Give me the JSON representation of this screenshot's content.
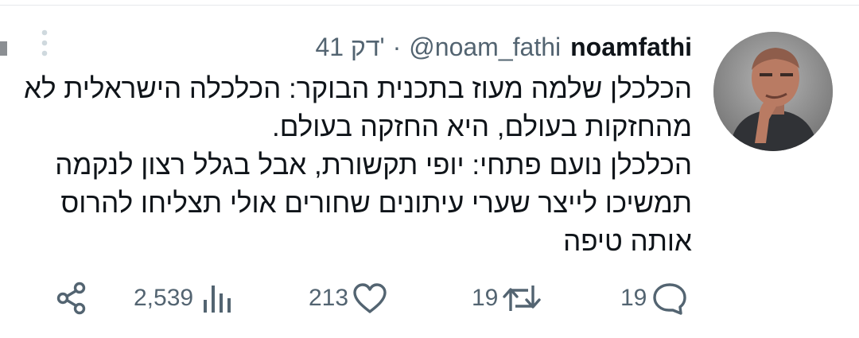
{
  "tweet": {
    "display_name": "noamfathi",
    "handle": "@noam_fathi",
    "separator": "·",
    "time": "41 דק'",
    "paragraphs": [
      "הכלכלן שלמה מעוז בתכנית הבוקר: הכלכלה הישראלית לא מהחזקות בעולם, היא החזקה בעולם.",
      "הכלכלן נועם פתחי: יופי תקשורת, אבל בגלל רצון לנקמה תמשיכו לייצר שערי עיתונים שחורים אולי תצליחו להרוס אותה טיפה"
    ]
  },
  "actions": {
    "replies": "19",
    "retweets": "19",
    "likes": "213",
    "views": "2,539"
  },
  "icons": {
    "more": "more-vertical-icon",
    "reply": "comment-bubble-icon",
    "retweet": "retweet-arrows-icon",
    "like": "heart-icon",
    "views": "bar-chart-icon",
    "share": "share-nodes-icon"
  },
  "colors": {
    "text": "#0f1419",
    "secondary": "#536471",
    "more_icon": "#cfd9de"
  }
}
